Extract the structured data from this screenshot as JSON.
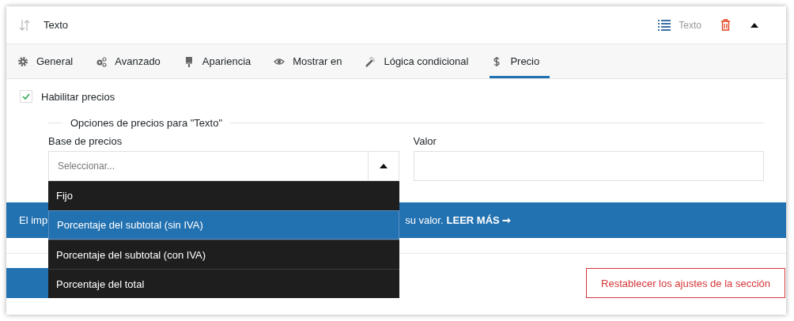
{
  "header": {
    "title": "Texto",
    "type_label": "Texto",
    "expanded": true
  },
  "tabs": [
    {
      "label": "General",
      "selected": false
    },
    {
      "label": "Avanzado",
      "selected": false
    },
    {
      "label": "Apariencia",
      "selected": false
    },
    {
      "label": "Mostrar en",
      "selected": false
    },
    {
      "label": "Lógica condicional",
      "selected": false
    },
    {
      "label": "Precio",
      "selected": true
    }
  ],
  "enable_pricing": {
    "label": "Habilitar precios",
    "checked": true
  },
  "pricing_options": {
    "legend": "Opciones de precios para \"Texto\"",
    "base": {
      "label": "Base de precios",
      "placeholder": "Seleccionar...",
      "expanded": true,
      "options": [
        {
          "label": "Fijo",
          "selected": false
        },
        {
          "label": "Porcentaje del subtotal (sin IVA)",
          "selected": true
        },
        {
          "label": "Porcentaje del subtotal (con IVA)",
          "selected": false
        },
        {
          "label": "Porcentaje del total",
          "selected": false
        }
      ]
    },
    "value": {
      "label": "Valor"
    }
  },
  "notice": {
    "text_start": "El imp",
    "text_end": "su valor.",
    "link": "LEER MÁS ➞"
  },
  "footer": {
    "reset_button": "Restablecer los ajustes de la sección"
  }
}
